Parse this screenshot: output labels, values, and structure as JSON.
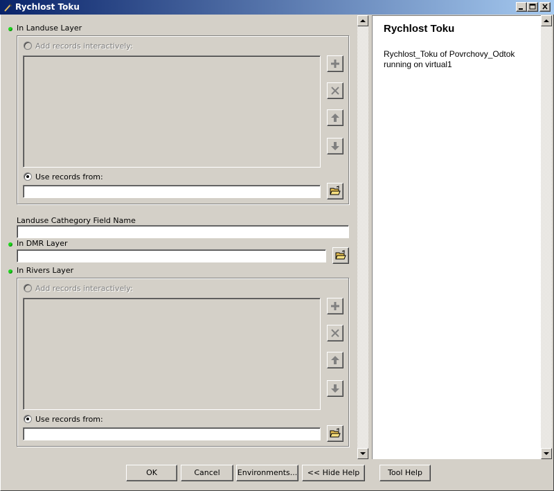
{
  "window": {
    "title": "Rychlost Toku"
  },
  "params": {
    "landuse_layer": {
      "label": "In Landuse Layer",
      "add_interactive_label": "Add records interactively:",
      "use_records_label": "Use records from:",
      "use_records_value": ""
    },
    "landuse_field": {
      "label": "Landuse Cathegory Field Name",
      "value": ""
    },
    "dmr_layer": {
      "label": "In DMR Layer",
      "value": ""
    },
    "rivers_layer": {
      "label": "In Rivers Layer",
      "add_interactive_label": "Add records interactively:",
      "use_records_label": "Use records from:",
      "use_records_value": ""
    }
  },
  "help": {
    "title": "Rychlost Toku",
    "description": "Rychlost_Toku of Povrchovy_Odtok running on virtual1"
  },
  "buttons": {
    "ok": "OK",
    "cancel": "Cancel",
    "environments": "Environments...",
    "hide_help": "<< Hide Help",
    "tool_help": "Tool Help"
  },
  "colors": {
    "title_gradient_start": "#0a246a",
    "title_gradient_end": "#a6caf0",
    "required_dot": "#1fd61f",
    "face": "#d4d0c8"
  },
  "icons": [
    "tool-icon",
    "minimize-icon",
    "maximize-icon",
    "close-icon",
    "plus-icon",
    "delete-icon",
    "arrow-up-icon",
    "arrow-down-icon",
    "open-folder-icon"
  ]
}
